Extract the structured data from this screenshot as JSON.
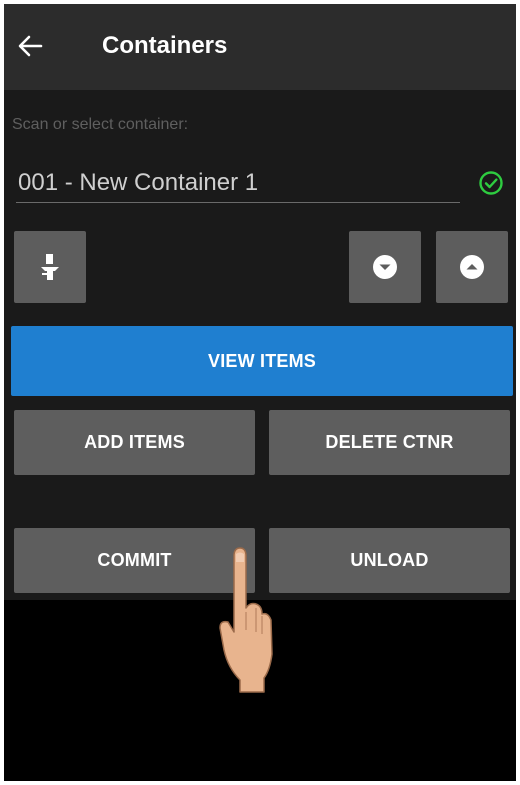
{
  "header": {
    "title": "Containers",
    "back_icon": "arrow-left-icon"
  },
  "container_select": {
    "label": "Scan or select container:",
    "value": "001 - New Container 1",
    "status_icon": "check-circle-icon",
    "status_color": "#2ecc40"
  },
  "toolbar": {
    "scan_icon": "barcode-scanner-icon",
    "prev_icon": "chevron-down-circle-icon",
    "next_icon": "chevron-up-circle-icon"
  },
  "actions": {
    "view_items": "VIEW ITEMS",
    "add_items": "ADD ITEMS",
    "delete_ctnr": "DELETE CTNR",
    "commit": "COMMIT",
    "unload": "UNLOAD"
  },
  "colors": {
    "accent": "#1f7fd0",
    "button": "#5e5e5e",
    "appbar": "#2c2c2c"
  }
}
